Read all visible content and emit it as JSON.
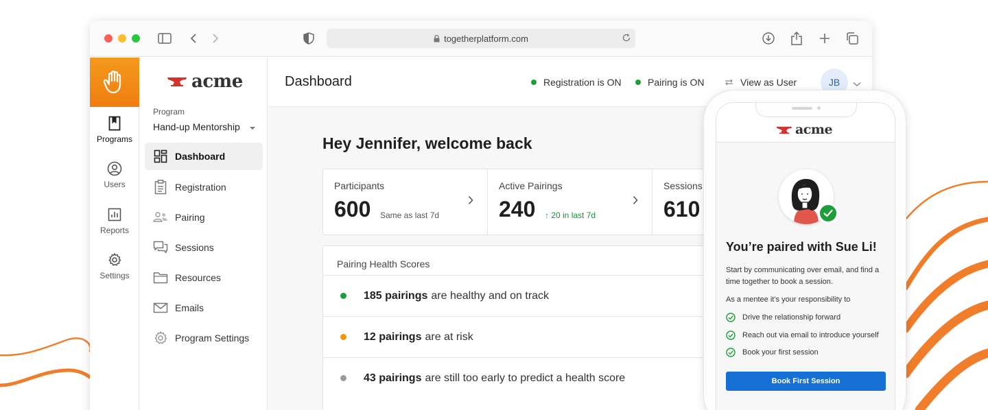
{
  "browser": {
    "url": "togetherplatform.com"
  },
  "rail": {
    "items": [
      {
        "label": "Programs",
        "icon": "bookmark-book-icon"
      },
      {
        "label": "Users",
        "icon": "user-circle-icon"
      },
      {
        "label": "Reports",
        "icon": "bar-chart-icon"
      },
      {
        "label": "Settings",
        "icon": "gear-icon"
      }
    ]
  },
  "brand": {
    "name": "acme"
  },
  "program": {
    "label": "Program",
    "selected": "Hand-up Mentorship"
  },
  "nav": {
    "items": [
      {
        "label": "Dashboard",
        "icon": "dashboard-grid-icon"
      },
      {
        "label": "Registration",
        "icon": "clipboard-icon"
      },
      {
        "label": "Pairing",
        "icon": "people-icon"
      },
      {
        "label": "Sessions",
        "icon": "chat-icon"
      },
      {
        "label": "Resources",
        "icon": "folder-icon"
      },
      {
        "label": "Emails",
        "icon": "envelope-icon"
      },
      {
        "label": "Program Settings",
        "icon": "gear-icon"
      }
    ]
  },
  "header": {
    "title": "Dashboard",
    "registration_status": "Registration is ON",
    "pairing_status": "Pairing is ON",
    "view_as": "View as User",
    "avatar_initials": "JB"
  },
  "dashboard": {
    "greeting": "Hey Jennifer, welcome back",
    "stats": [
      {
        "label": "Participants",
        "value": "600",
        "note": "Same as last 7d"
      },
      {
        "label": "Active Pairings",
        "value": "240",
        "note": "↑ 20 in last 7d"
      },
      {
        "label": "Sessions",
        "value": "610",
        "note": ""
      }
    ],
    "health": {
      "title": "Pairing Health Scores",
      "rows": [
        {
          "count": "185 pairings",
          "text": "are healthy and on track",
          "color": "#1e9e3a"
        },
        {
          "count": "12 pairings",
          "text": "are at risk",
          "color": "#f0960e"
        },
        {
          "count": "43 pairings",
          "text": "are still too early to predict a health score",
          "color": "#9a9a9a"
        }
      ]
    }
  },
  "phone": {
    "title": "You’re paired with Sue Li!",
    "intro": "Start by communicating over email, and find a time together to book a session.",
    "responsibility": "As a mentee it’s your responsibility to",
    "checklist": [
      "Drive the relationship forward",
      "Reach out via email to introduce yourself",
      "Book your first session"
    ],
    "button": "Book First Session"
  },
  "colors": {
    "accent_orange": "#f39a1d",
    "brand_red": "#d6322b",
    "primary_blue": "#1670d4",
    "healthy_green": "#1e9e3a"
  }
}
